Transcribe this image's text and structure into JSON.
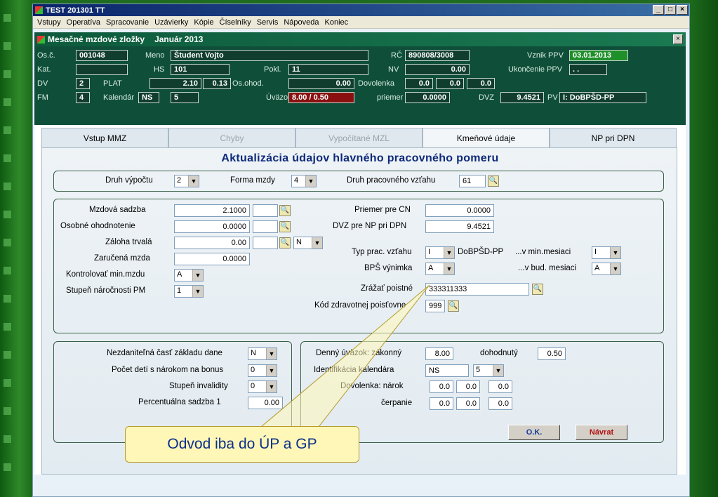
{
  "app": {
    "title": "TEST 201301 TT",
    "menu": [
      "Vstupy",
      "Operatíva",
      "Spracovanie",
      "Uzávierky",
      "Kópie",
      "Číselníky",
      "Servis",
      "Nápoveda",
      "Koniec"
    ]
  },
  "form": {
    "title": "Mesačné mzdové zložky",
    "period": "Január 2013",
    "header": {
      "osc_label": "Os.č.",
      "osc_value": "001048",
      "meno_label": "Meno",
      "meno_value": "Študent Vojto",
      "rc_label": "RČ",
      "rc_value": "890808/3008",
      "vznik_label": "Vznik PPV",
      "vznik_value": "03.01.2013",
      "kat_label": "Kat.",
      "kat_value": "",
      "hs_label": "HS",
      "hs_value": "101",
      "pokl_label": "Pokl.",
      "pokl_value": "11",
      "nv_label": "NV",
      "nv_value": "0.00",
      "ukonc_label": "Ukončenie PPV",
      "ukonc_value": ". .",
      "dv_label": "DV",
      "dv_value": "2",
      "plat_label": "PLAT",
      "plat_value1": "2.10",
      "plat_value2": "0.13",
      "osohod_label": "Os.ohod.",
      "osohod_value": "0.00",
      "dovolenka_label": "Dovolenka",
      "dov1": "0.0",
      "dov2": "0.0",
      "dov3": "0.0",
      "fm_label": "FM",
      "fm_value": "4",
      "kalendar_label": "Kalendár",
      "kalendar_value": "NS",
      "kalendar_num": "5",
      "uvazok_label": "Úväzok",
      "uvazok_value": "8.00 / 0.50",
      "priemer_label": "priemer",
      "priemer_value": "0.0000",
      "dvz_label": "DVZ",
      "dvz_value": "9.4521",
      "pv_label": "PV",
      "pv_value": "I: DoBPŠD-PP"
    },
    "tabs": [
      {
        "label": "Vstup MMZ",
        "state": "normal"
      },
      {
        "label": "Chyby",
        "state": "disabled"
      },
      {
        "label": "Vypočítané MZL",
        "state": "disabled"
      },
      {
        "label": "Kmeňové údaje",
        "state": "active"
      },
      {
        "label": "NP pri DPN",
        "state": "normal"
      }
    ],
    "content": {
      "title": "Aktualizácia údajov hlavného pracovného pomeru",
      "druh_vypoctu_label": "Druh výpočtu",
      "druh_vypoctu_value": "2",
      "forma_mzdy_label": "Forma mzdy",
      "forma_mzdy_value": "4",
      "druh_pv_label": "Druh pracovného vzťahu",
      "druh_pv_value": "61",
      "mzdova_sadzba_label": "Mzdová sadzba",
      "mzdova_sadzba_value": "2.1000",
      "osobne_hodn_label": "Osobné ohodnotenie",
      "osobne_hodn_value": "0.0000",
      "zaloha_label": "Záloha trvalá",
      "zaloha_value": "0.00",
      "zaloha_dd": "N",
      "zarucena_label": "Zaručená mzda",
      "zarucena_value": "0.0000",
      "kontrolovat_label": "Kontrolovať min.mzdu",
      "kontrolovat_value": "A",
      "stupen_pm_label": "Stupeň náročnosti PM",
      "stupen_pm_value": "1",
      "priemer_cn_label": "Priemer pre CN",
      "priemer_cn_value": "0.0000",
      "dvz_np_label": "DVZ pre NP pri DPN",
      "dvz_np_value": "9.4521",
      "typ_pv_label": "Typ prac. vzťahu",
      "typ_pv_value": "I",
      "typ_pv_text": "DoBPŠD-PP",
      "vmin_label": "...v min.mesiaci",
      "vmin_value": "I",
      "bps_label": "BPŠ výnimka",
      "bps_value": "A",
      "vbud_label": "...v bud. mesiaci",
      "vbud_value": "A",
      "zrazat_label": "Zrážať poistné",
      "zrazat_value": "333311333",
      "kod_zp_label": "Kód zdravotnej poisťovne",
      "kod_zp_value": "999",
      "nezdanitelna_label": "Nezdaniteľná časť základu dane",
      "nezdanitelna_value": "N",
      "pocet_deti_label": "Počet detí s nárokom na bonus",
      "pocet_deti_value": "0",
      "invalidita_label": "Stupeň invalidity",
      "invalidita_value": "0",
      "perc_sadzba_label": "Percentuálna sadzba 1",
      "perc_sadzba_value": "0.00",
      "denny_label": "Denný úväzok: zákonný",
      "denny_value": "8.00",
      "dohodnuty_label": "dohodnutý",
      "dohodnuty_value": "0.50",
      "ident_kal_label": "Identifikácia kalendára",
      "ident_kal_value": "NS",
      "ident_kal_num": "5",
      "dov_narok_label": "Dovolenka: nárok",
      "dn1": "0.0",
      "dn2": "0.0",
      "dn3": "0.0",
      "cerpanie_label": "čerpanie",
      "dc1": "0.0",
      "dc2": "0.0",
      "dc3": "0.0",
      "ok_label": "O.K.",
      "navrat_label": "Návrat"
    }
  },
  "callout": {
    "text": "Odvod iba do ÚP a GP"
  },
  "colors": {
    "header_bg": "#0f4f3a",
    "title_blue": "#0e2a7a",
    "callout_fill": "#fff7b8",
    "warning_red": "#8a1010",
    "date_green": "#1f8f2a"
  }
}
